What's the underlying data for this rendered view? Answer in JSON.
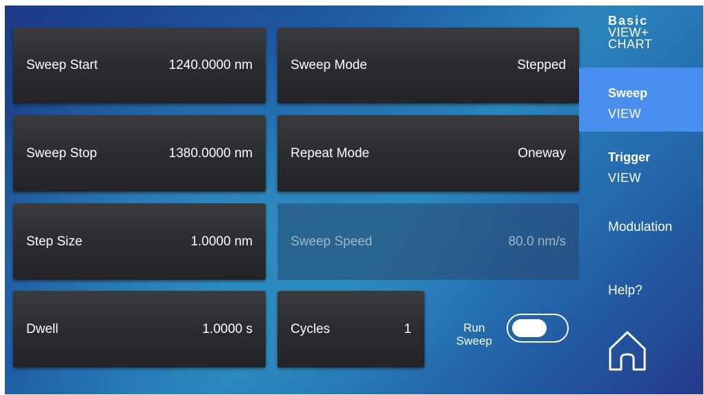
{
  "params": {
    "sweep_start": {
      "label": "Sweep Start",
      "value": "1240.0000 nm"
    },
    "sweep_mode": {
      "label": "Sweep Mode",
      "value": "Stepped"
    },
    "sweep_stop": {
      "label": "Sweep Stop",
      "value": "1380.0000 nm"
    },
    "repeat_mode": {
      "label": "Repeat Mode",
      "value": "Oneway"
    },
    "step_size": {
      "label": "Step Size",
      "value": "1.0000 nm"
    },
    "sweep_speed": {
      "label": "Sweep Speed",
      "value": "80.0 nm/s",
      "enabled": false
    },
    "dwell": {
      "label": "Dwell",
      "value": "1.0000 s"
    },
    "cycles": {
      "label": "Cycles",
      "value": "1"
    }
  },
  "run_sweep": {
    "label_line1": "Run",
    "label_line2": "Sweep",
    "state": "off"
  },
  "nav": {
    "basic": {
      "line1": "Basic",
      "line2": "VIEW+",
      "line3": "CHART"
    },
    "sweep": {
      "line1": "Sweep",
      "line2": "VIEW",
      "active": true
    },
    "trigger": {
      "line1": "Trigger",
      "line2": "VIEW"
    },
    "modulation": {
      "label": "Modulation"
    },
    "help": {
      "label": "Help?"
    },
    "home": {
      "icon": "home-icon"
    }
  },
  "colors": {
    "active_nav": "#4a8ff0",
    "tile": "#2e2f33",
    "tile_disabled_text": "#9fb5cc"
  }
}
